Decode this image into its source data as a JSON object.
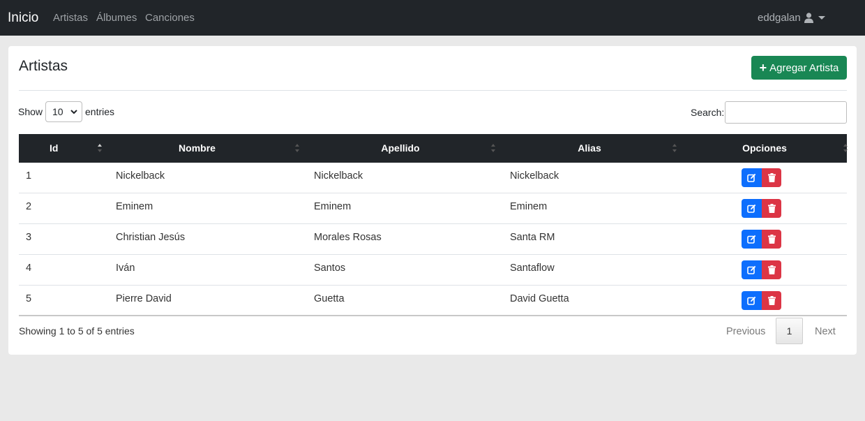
{
  "nav": {
    "brand": "Inicio",
    "links": [
      "Artistas",
      "Álbumes",
      "Canciones"
    ],
    "user": "eddgalan",
    "user_icon": "user-icon",
    "bg_color": "#212529"
  },
  "page": {
    "title": "Artistas",
    "add_button_label": "Agregar Artista",
    "add_button_color": "#198754"
  },
  "controls": {
    "show_label": "Show",
    "page_length": "10",
    "entries_label": "entries",
    "search_label": "Search:",
    "search_value": ""
  },
  "table": {
    "columns": [
      "Id",
      "Nombre",
      "Apellido",
      "Alias",
      "Opciones"
    ],
    "rows": [
      {
        "id": "1",
        "nombre": "Nickelback",
        "apellido": "Nickelback",
        "alias": "Nickelback"
      },
      {
        "id": "2",
        "nombre": "Eminem",
        "apellido": "Eminem",
        "alias": "Eminem"
      },
      {
        "id": "3",
        "nombre": "Christian Jesús",
        "apellido": "Morales Rosas",
        "alias": "Santa RM"
      },
      {
        "id": "4",
        "nombre": "Iván",
        "apellido": "Santos",
        "alias": "Santaflow"
      },
      {
        "id": "5",
        "nombre": "Pierre David",
        "apellido": "Guetta",
        "alias": "David Guetta"
      }
    ],
    "edit_icon": "edit-icon",
    "delete_icon": "trash-icon",
    "edit_color": "#0d6efd",
    "delete_color": "#dc3545"
  },
  "footer": {
    "info": "Showing 1 to 5 of 5 entries",
    "previous": "Previous",
    "current_page": "1",
    "next": "Next"
  }
}
